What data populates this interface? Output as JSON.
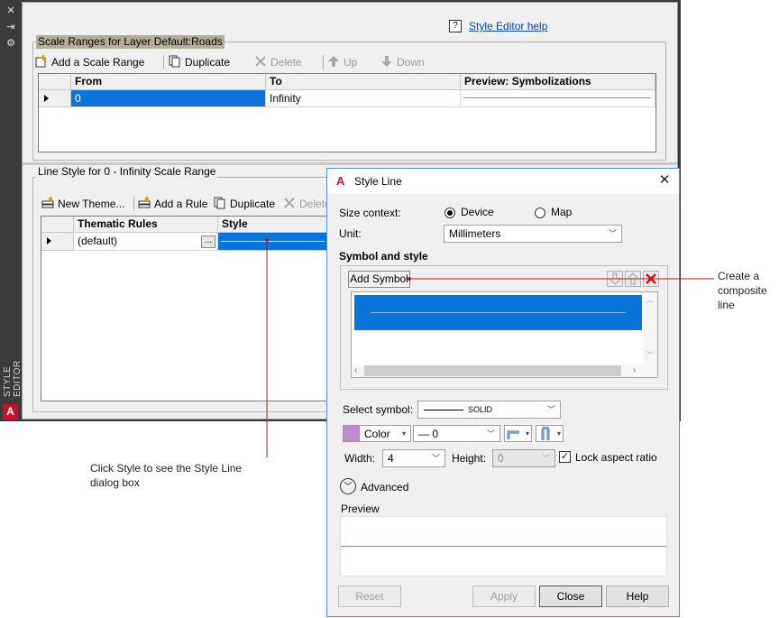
{
  "editor": {
    "side_title": "STYLE EDITOR",
    "logo": "A",
    "help_link": "Style Editor help",
    "scale_ranges": {
      "title": "Scale Ranges for Layer Default:Roads",
      "toolbar": {
        "add": "Add a Scale Range",
        "duplicate": "Duplicate",
        "delete": "Delete",
        "up": "Up",
        "down": "Down"
      },
      "columns": [
        "From",
        "To",
        "Preview: Symbolizations"
      ],
      "row": {
        "from": "0",
        "to": "Infinity"
      }
    },
    "line_style": {
      "title": "Line Style for 0 - Infinity Scale Range",
      "toolbar": {
        "new_theme": "New Theme...",
        "add_rule": "Add a Rule",
        "duplicate": "Duplicate",
        "delete": "Delete"
      },
      "columns": [
        "Thematic Rules",
        "Style"
      ],
      "row": {
        "rule": "(default)",
        "ellipsis": "..."
      }
    }
  },
  "dialog": {
    "title": "Style Line",
    "size_context_label": "Size context:",
    "device": "Device",
    "map": "Map",
    "unit_label": "Unit:",
    "unit_value": "Millimeters",
    "symbol_style_heading": "Symbol and style",
    "add_symbol": "Add Symbol",
    "select_symbol_label": "Select symbol:",
    "symbol_value": "SOLID",
    "color_label": "Color",
    "color_swatch": "#c08ccc",
    "lineweight_value": "0",
    "width_label": "Width:",
    "width_value": "4",
    "height_label": "Height:",
    "height_value": "0",
    "lock_label": "Lock aspect ratio",
    "advanced_label": "Advanced",
    "preview_label": "Preview",
    "buttons": {
      "reset": "Reset",
      "apply": "Apply",
      "close": "Close",
      "help": "Help"
    }
  },
  "callouts": {
    "composite_line": "Create a\ncomposite\nline",
    "style_click": "Click Style to see the Style Line\ndialog box"
  },
  "colors": {
    "selection": "#0a74da",
    "callout_line": "#b01818",
    "preview_line": "#a07ab0",
    "delete_red": "#d01010",
    "logo": "#c8102e"
  }
}
